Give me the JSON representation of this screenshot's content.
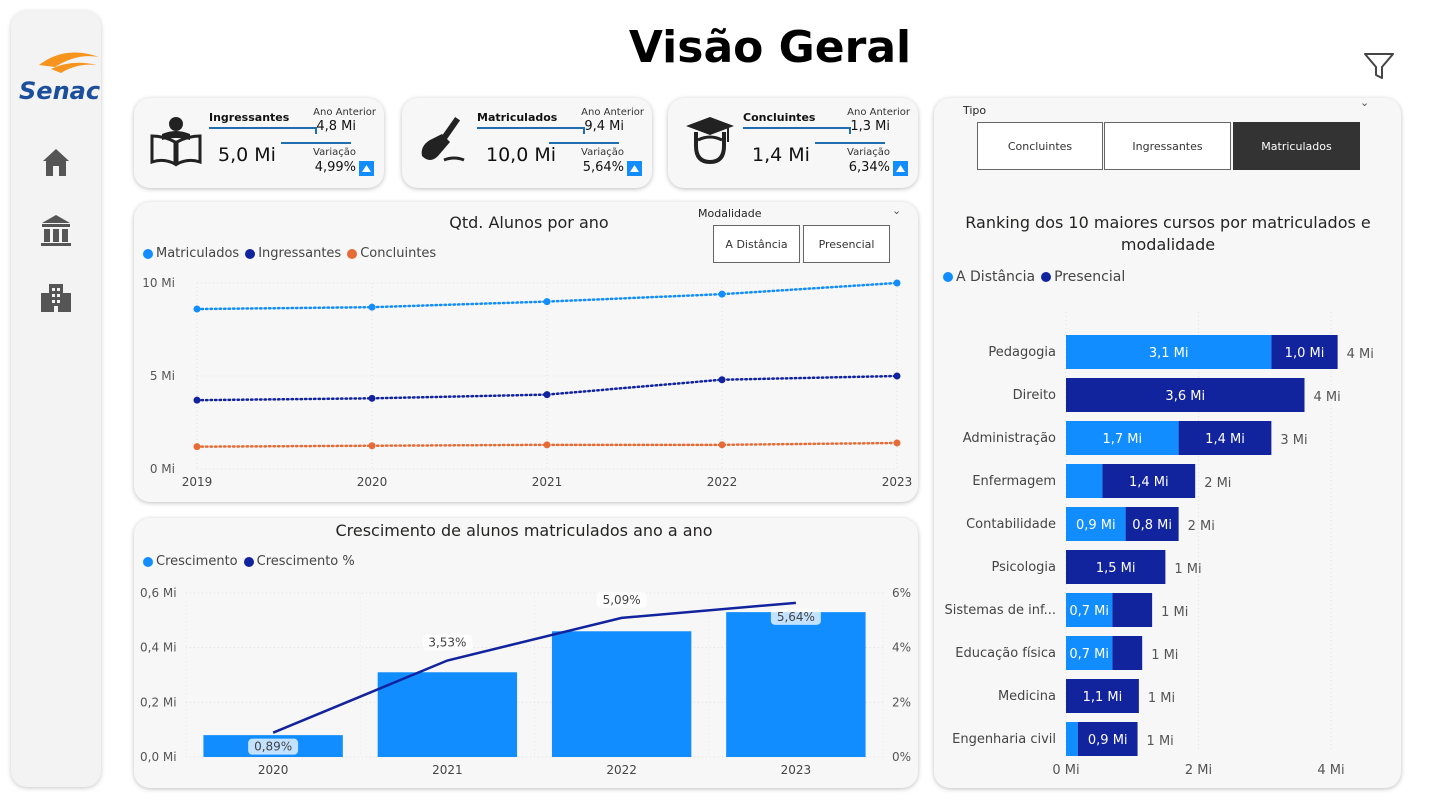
{
  "page": {
    "title": "Visão Geral"
  },
  "sidebar": {
    "logo_text": "Senac",
    "items": [
      {
        "name": "home-icon"
      },
      {
        "name": "library-icon"
      },
      {
        "name": "building-icon"
      }
    ]
  },
  "kpis": [
    {
      "icon": "reading-book-icon",
      "label": "Ingressantes",
      "value": "5,0 Mi",
      "prev_label": "Ano Anterior",
      "prev_value": "4,8 Mi",
      "var_label": "Variação",
      "var_value": "4,99%"
    },
    {
      "icon": "writing-hand-icon",
      "label": "Matriculados",
      "value": "10,0 Mi",
      "prev_label": "Ano Anterior",
      "prev_value": "9,4 Mi",
      "var_label": "Variação",
      "var_value": "5,64%"
    },
    {
      "icon": "graduate-icon",
      "label": "Concluintes",
      "value": "1,4 Mi",
      "prev_label": "Ano Anterior",
      "prev_value": "1,3 Mi",
      "var_label": "Variação",
      "var_value": "6,34%"
    }
  ],
  "tipo_slicer": {
    "title": "Tipo",
    "options": [
      "Concluintes",
      "Ingressantes",
      "Matriculados"
    ],
    "selected": "Matriculados"
  },
  "modalidade_slicer": {
    "title": "Modalidade",
    "options": [
      "A Distância",
      "Presencial"
    ]
  },
  "colors": {
    "matriculados": "#118dff",
    "ingressantes": "#12239e",
    "concluintes": "#e66c37",
    "a_distancia": "#118dff",
    "presencial": "#12239e"
  },
  "chart_data": [
    {
      "type": "line",
      "title": "Qtd. Alunos por ano",
      "x": [
        "2019",
        "2020",
        "2021",
        "2022",
        "2023"
      ],
      "series": [
        {
          "name": "Matriculados",
          "values": [
            8.6,
            8.7,
            9.0,
            9.4,
            10.0
          ]
        },
        {
          "name": "Ingressantes",
          "values": [
            3.7,
            3.8,
            4.0,
            4.8,
            5.0
          ]
        },
        {
          "name": "Concluintes",
          "values": [
            1.2,
            1.25,
            1.3,
            1.3,
            1.4
          ]
        }
      ],
      "y_ticks": [
        "0 Mi",
        "5 Mi",
        "10 Mi"
      ],
      "ylim": [
        0,
        10
      ]
    },
    {
      "type": "bar",
      "title": "Crescimento de alunos matriculados ano a ano",
      "categories": [
        "2020",
        "2021",
        "2022",
        "2023"
      ],
      "series": [
        {
          "name": "Crescimento",
          "values": [
            0.08,
            0.31,
            0.46,
            0.53
          ]
        },
        {
          "name": "Crescimento %",
          "values": [
            0.89,
            3.53,
            5.09,
            5.64
          ],
          "labels": [
            "0,89%",
            "3,53%",
            "5,09%",
            "5,64%"
          ]
        }
      ],
      "y_ticks_left": [
        "0,0 Mi",
        "0,2 Mi",
        "0,4 Mi",
        "0,6 Mi"
      ],
      "y_ticks_right": [
        "0%",
        "2%",
        "4%",
        "6%"
      ],
      "ylim": [
        0,
        0.6
      ],
      "ylim_right": [
        0,
        6
      ]
    },
    {
      "type": "bar",
      "orientation": "horizontal-stacked",
      "title": "Ranking dos 10 maiores cursos por matriculados e modalidade",
      "categories": [
        "Pedagogia",
        "Direito",
        "Administração",
        "Enfermagem",
        "Contabilidade",
        "Psicologia",
        "Sistemas de inf...",
        "Educação física",
        "Medicina",
        "Engenharia civil"
      ],
      "series": [
        {
          "name": "A Distância",
          "values": [
            3.1,
            0,
            1.7,
            0.55,
            0.9,
            0,
            0.7,
            0.7,
            0,
            0.18
          ],
          "labels": [
            "3,1 Mi",
            "",
            "1,7 Mi",
            "",
            "0,9 Mi",
            "",
            "0,7 Mi",
            "0,7 Mi",
            "",
            ""
          ]
        },
        {
          "name": "Presencial",
          "values": [
            1.0,
            3.6,
            1.4,
            1.4,
            0.8,
            1.5,
            0.6,
            0.45,
            1.1,
            0.9
          ],
          "labels": [
            "1,0 Mi",
            "3,6 Mi",
            "1,4 Mi",
            "1,4 Mi",
            "0,8 Mi",
            "1,5 Mi",
            "",
            "",
            "1,1 Mi",
            "0,9 Mi"
          ]
        }
      ],
      "total_labels": [
        "4 Mi",
        "4 Mi",
        "3 Mi",
        "2 Mi",
        "2 Mi",
        "1 Mi",
        "1 Mi",
        "1 Mi",
        "1 Mi",
        "1 Mi"
      ],
      "x_ticks": [
        "0 Mi",
        "2 Mi",
        "4 Mi"
      ],
      "xlim": [
        0,
        4
      ]
    }
  ]
}
